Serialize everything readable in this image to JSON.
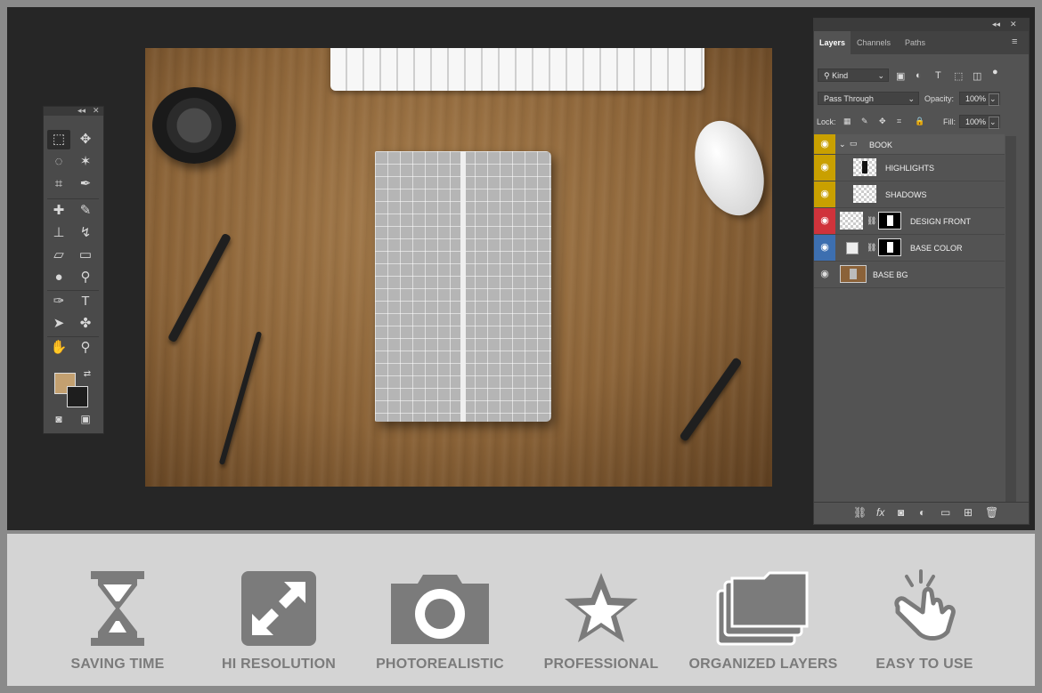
{
  "tools": {
    "collapse_icon": "double-chevron-left",
    "close_icon": "close",
    "items": [
      {
        "name": "marquee-tool-icon",
        "glyph": "⬚"
      },
      {
        "name": "move-tool-icon",
        "glyph": "✥"
      },
      {
        "name": "lasso-tool-icon",
        "glyph": "◌"
      },
      {
        "name": "magic-wand-tool-icon",
        "glyph": "✶"
      },
      {
        "name": "crop-tool-icon",
        "glyph": "⌗"
      },
      {
        "name": "eyedropper-tool-icon",
        "glyph": "✒"
      },
      {
        "name": "healing-brush-tool-icon",
        "glyph": "✚"
      },
      {
        "name": "brush-tool-icon",
        "glyph": "✎"
      },
      {
        "name": "clone-stamp-tool-icon",
        "glyph": "⊥"
      },
      {
        "name": "history-brush-tool-icon",
        "glyph": "↯"
      },
      {
        "name": "eraser-tool-icon",
        "glyph": "▱"
      },
      {
        "name": "gradient-tool-icon",
        "glyph": "▭"
      },
      {
        "name": "blur-tool-icon",
        "glyph": "●"
      },
      {
        "name": "dodge-tool-icon",
        "glyph": "⚲"
      },
      {
        "name": "pen-tool-icon",
        "glyph": "✑"
      },
      {
        "name": "type-tool-icon",
        "glyph": "T"
      },
      {
        "name": "path-selection-tool-icon",
        "glyph": "➤"
      },
      {
        "name": "shape-tool-icon",
        "glyph": "✤"
      },
      {
        "name": "hand-tool-icon",
        "glyph": "✋"
      },
      {
        "name": "zoom-tool-icon",
        "glyph": "⚲"
      }
    ],
    "foreground_color": "#c3a070",
    "background_color": "#1e1e1e"
  },
  "layers_panel": {
    "tabs": [
      "Layers",
      "Channels",
      "Paths"
    ],
    "active_tab": "Layers",
    "filter_kind": "Kind",
    "blend_mode": "Pass Through",
    "opacity_label": "Opacity:",
    "opacity_value": "100%",
    "lock_label": "Lock:",
    "fill_label": "Fill:",
    "fill_value": "100%",
    "layers": [
      {
        "name": "BOOK",
        "type": "group",
        "eye_color": "#c9a000"
      },
      {
        "name": "HIGHLIGHTS",
        "type": "layer",
        "eye_color": "#c9a000"
      },
      {
        "name": "SHADOWS",
        "type": "layer",
        "eye_color": "#c9a000"
      },
      {
        "name": "DESIGN FRONT",
        "type": "smart",
        "eye_color": "#d0333b"
      },
      {
        "name": "BASE COLOR",
        "type": "fill",
        "eye_color": "#3d6fb0"
      },
      {
        "name": "BASE BG",
        "type": "image",
        "eye_color": "#535353"
      }
    ]
  },
  "features": [
    {
      "label": "SAVING TIME",
      "icon": "hourglass-icon"
    },
    {
      "label": "HI RESOLUTION",
      "icon": "expand-arrows-icon"
    },
    {
      "label": "PHOTOREALISTIC",
      "icon": "camera-icon"
    },
    {
      "label": "PROFESSIONAL",
      "icon": "star-icon"
    },
    {
      "label": "ORGANIZED LAYERS",
      "icon": "stacked-folders-icon"
    },
    {
      "label": "EASY TO USE",
      "icon": "tap-hand-icon"
    }
  ]
}
